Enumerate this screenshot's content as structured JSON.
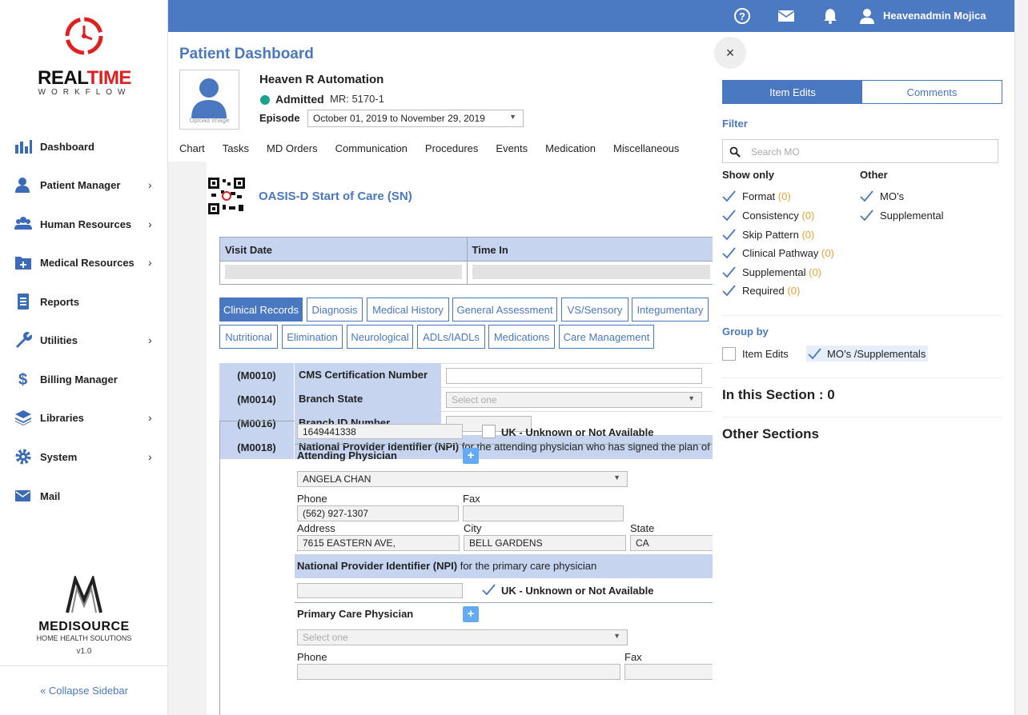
{
  "app": {
    "brand_main_1": "REAL",
    "brand_main_2": "TIME",
    "brand_sub": "WORKFLOW",
    "footer_brand": "MEDISOURCE",
    "footer_sub": "HOME HEALTH SOLUTIONS",
    "version": "v1.0",
    "collapse_label": "« Collapse Sidebar"
  },
  "sidebar": {
    "items": [
      {
        "label": "Dashboard",
        "icon": "bar-chart-icon",
        "has_children": false
      },
      {
        "label": "Patient Manager",
        "icon": "user-icon",
        "has_children": true
      },
      {
        "label": "Human Resources",
        "icon": "group-icon",
        "has_children": true
      },
      {
        "label": "Medical Resources",
        "icon": "medical-folder-icon",
        "has_children": true
      },
      {
        "label": "Reports",
        "icon": "report-icon",
        "has_children": false
      },
      {
        "label": "Utilities",
        "icon": "wrench-icon",
        "has_children": true
      },
      {
        "label": "Billing Manager",
        "icon": "dollar-icon",
        "has_children": false
      },
      {
        "label": "Libraries",
        "icon": "layers-icon",
        "has_children": true
      },
      {
        "label": "System",
        "icon": "gear-icon",
        "has_children": true
      },
      {
        "label": "Mail",
        "icon": "mail-icon",
        "has_children": false
      }
    ]
  },
  "topbar": {
    "user_name": "Heavenadmin Mojica",
    "color": "#4b79c2"
  },
  "patient": {
    "page_title": "Patient Dashboard",
    "upload_caption": "Upload Image",
    "name": "Heaven R Automation",
    "status": "Admitted",
    "mr": "MR: 5170-1",
    "episode_label": "Episode",
    "episode_value": "October 01, 2019 to November 29, 2019"
  },
  "tabs": [
    "Chart",
    "Tasks",
    "MD Orders",
    "Communication",
    "Procedures",
    "Events",
    "Medication",
    "Miscellaneous"
  ],
  "form": {
    "title": "OASIS-D Start of Care (SN)",
    "visit_date_label": "Visit Date",
    "time_in_label": "Time In",
    "sections_row1": [
      "Clinical Records",
      "Diagnosis",
      "Medical History",
      "General Assessment",
      "VS/Sensory",
      "Integumentary"
    ],
    "sections_row2": [
      "Nutritional",
      "Elimination",
      "Neurological",
      "ADLs/IADLs",
      "Medications",
      "Care Management"
    ],
    "m0010": {
      "code": "(M0010)",
      "label": "CMS Certification Number"
    },
    "m0014": {
      "code": "(M0014)",
      "label": "Branch State",
      "placeholder": "Select one"
    },
    "m0016": {
      "code": "(M0016)",
      "label": "Branch ID Number"
    },
    "m0018": {
      "code": "(M0018)",
      "label_bold": "National Provider Identifier (NPI)",
      "label_rest": " for the attending physician who has signed the plan of"
    },
    "attending": {
      "npi": "1649441338",
      "uk_label": "UK - Unknown or Not Available",
      "physician_label": "Attending Physician",
      "physician_value": "ANGELA CHAN",
      "phone_label": "Phone",
      "phone_value": "(562) 927-1307",
      "fax_label": "Fax",
      "address_label": "Address",
      "address_value": "7615 EASTERN AVE,",
      "city_label": "City",
      "city_value": "BELL GARDENS",
      "state_label": "State",
      "state_value": "CA"
    },
    "primary": {
      "npi_label_bold": "National Provider Identifier (NPI)",
      "npi_label_rest": " for the primary care physician",
      "uk_label": "UK - Unknown or Not Available",
      "physician_label": "Primary Care Physician",
      "physician_placeholder": "Select one",
      "phone_label": "Phone",
      "fax_label": "Fax"
    },
    "plus": "+"
  },
  "panel": {
    "close": "×",
    "tab_edits": "Item Edits",
    "tab_comments": "Comments",
    "filter_label": "Filter",
    "search_placeholder": "Search MO",
    "show_only_label": "Show only",
    "other_label": "Other",
    "show_only": [
      {
        "label": "Format",
        "count": "(0)"
      },
      {
        "label": "Consistency",
        "count": "(0)"
      },
      {
        "label": "Skip Pattern",
        "count": "(0)"
      },
      {
        "label": "Clinical Pathway",
        "count": "(0)"
      },
      {
        "label": "Supplemental",
        "count": "(0)"
      },
      {
        "label": "Required",
        "count": "(0)"
      }
    ],
    "other": [
      "MO’s",
      "Supplemental"
    ],
    "group_by_label": "Group by",
    "group_item_edits": "Item Edits",
    "group_mos": "MO’s /Supplementals",
    "in_section": "In this Section : 0",
    "other_sections": "Other Sections",
    "accent_color": "#4a78c0",
    "count_color": "#f0a030"
  }
}
